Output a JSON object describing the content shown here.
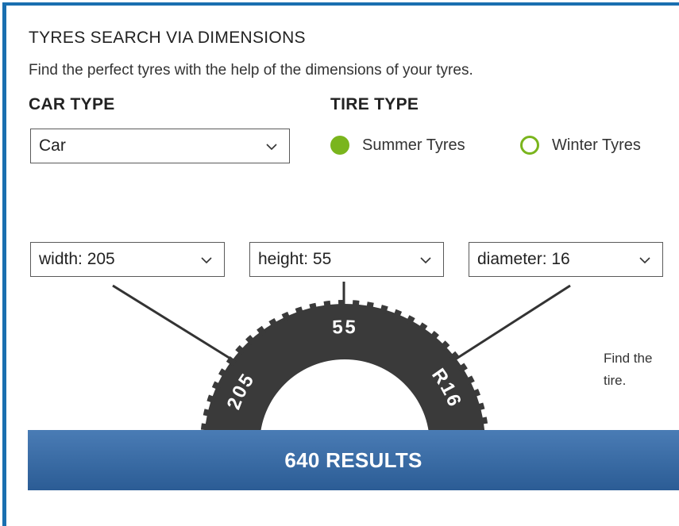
{
  "header": {
    "title": "TYRES SEARCH VIA DIMENSIONS",
    "subtitle": "Find the perfect tyres with the help of the dimensions of your tyres."
  },
  "car_type": {
    "label": "CAR TYPE",
    "selected": "Car",
    "icon": "chevron-down-icon"
  },
  "tire_type": {
    "label": "TIRE TYPE",
    "options": [
      {
        "label": "Summer Tyres",
        "selected": true
      },
      {
        "label": "Winter Tyres",
        "selected": false
      }
    ]
  },
  "dimensions": {
    "width": {
      "text": "width: 205"
    },
    "height": {
      "text": "height: 55"
    },
    "diameter": {
      "text": "diameter: 16"
    }
  },
  "tire_graphic": {
    "width_label": "205",
    "height_label": "55",
    "diameter_label": "R16"
  },
  "side_text": {
    "line1": "Find the",
    "line2": "tire."
  },
  "results": {
    "label": "640 RESULTS"
  },
  "colors": {
    "accent_border": "#1a6fb0",
    "radio_green": "#7ab51d",
    "results_bar": "#3a6da6",
    "tire": "#3a3a3a"
  }
}
